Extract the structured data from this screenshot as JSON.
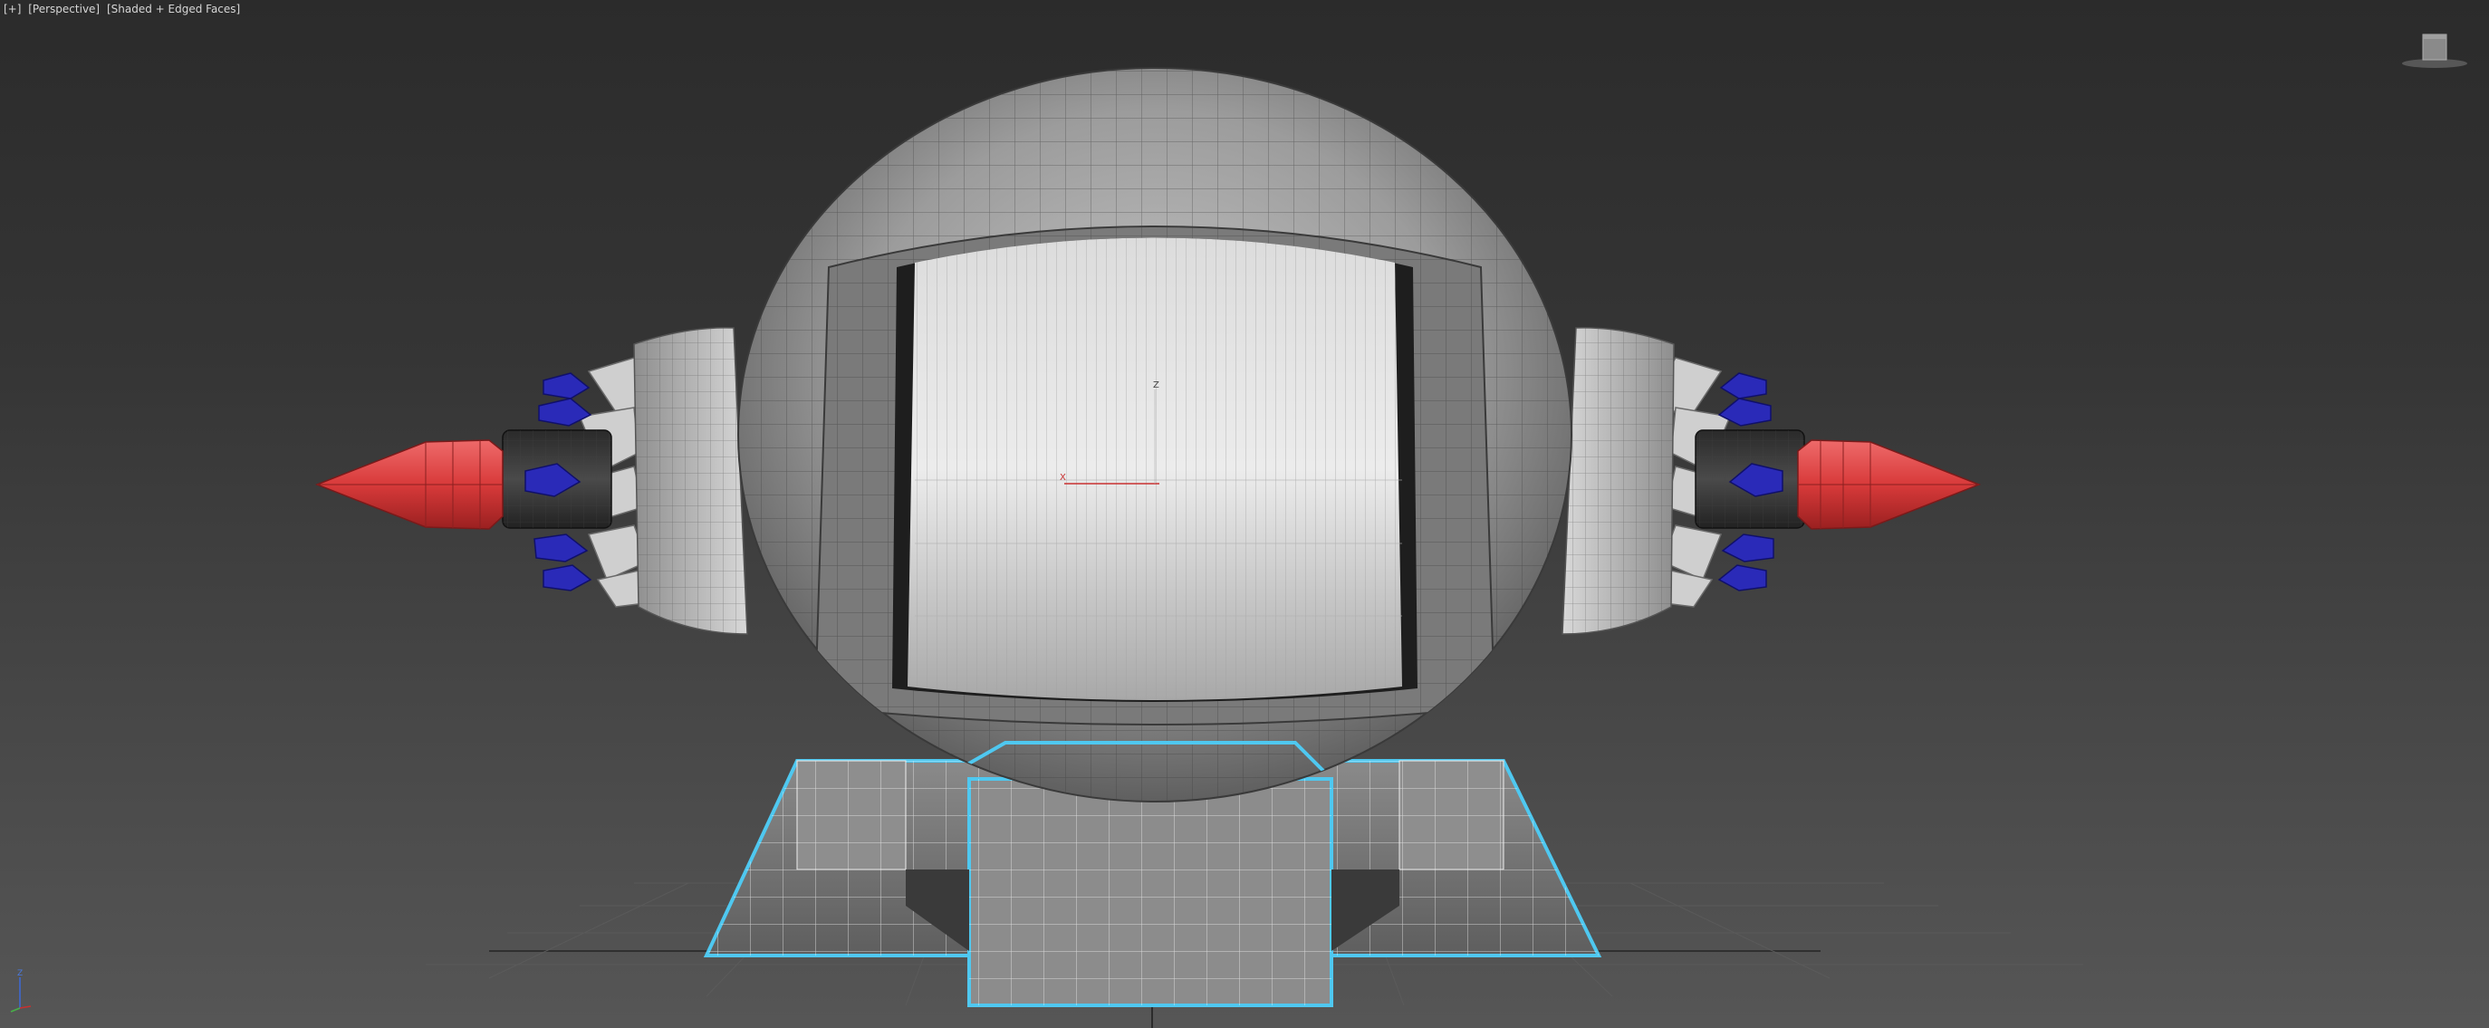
{
  "viewport": {
    "label": {
      "menu": "[+]",
      "view": "[Perspective]",
      "shading": "[Shaded + Edged Faces]"
    },
    "gizmo_axes": {
      "x": "X",
      "z": "Z"
    },
    "tripod_axes": {
      "z": "Z"
    }
  },
  "colors": {
    "background_top": "#2b2b2b",
    "background_bottom": "#565656",
    "mesh_gray": "#9a9a9a",
    "selection_highlight": "#4fc8f0",
    "nozzle_red": "#d83a3a",
    "fin_blue": "#2a2ab8",
    "gizmo_x_red": "#c83030"
  },
  "icons": [
    "viewcube-icon",
    "axis-tripod-icon",
    "transform-gizmo-icon"
  ]
}
